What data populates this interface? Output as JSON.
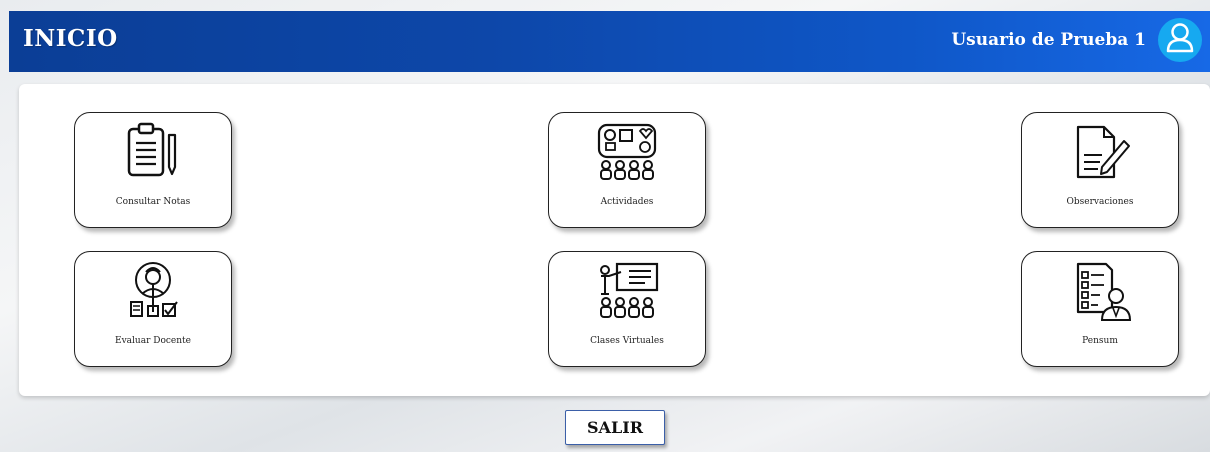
{
  "header": {
    "title": "INICIO",
    "user_name": "Usuario de Prueba 1",
    "avatar_icon": "user-icon",
    "accent_color": "#0d47a9"
  },
  "menu": {
    "cards": [
      {
        "label": "Consultar Notas",
        "icon": "clipboard-pencil-icon"
      },
      {
        "label": "Actividades",
        "icon": "activities-board-icon"
      },
      {
        "label": "Observaciones",
        "icon": "document-edit-icon"
      },
      {
        "label": "Evaluar Docente",
        "icon": "teacher-evaluation-icon"
      },
      {
        "label": "Clases Virtuales",
        "icon": "virtual-class-icon"
      },
      {
        "label": "Pensum",
        "icon": "checklist-person-icon"
      }
    ]
  },
  "footer": {
    "exit_label": "SALIR"
  }
}
